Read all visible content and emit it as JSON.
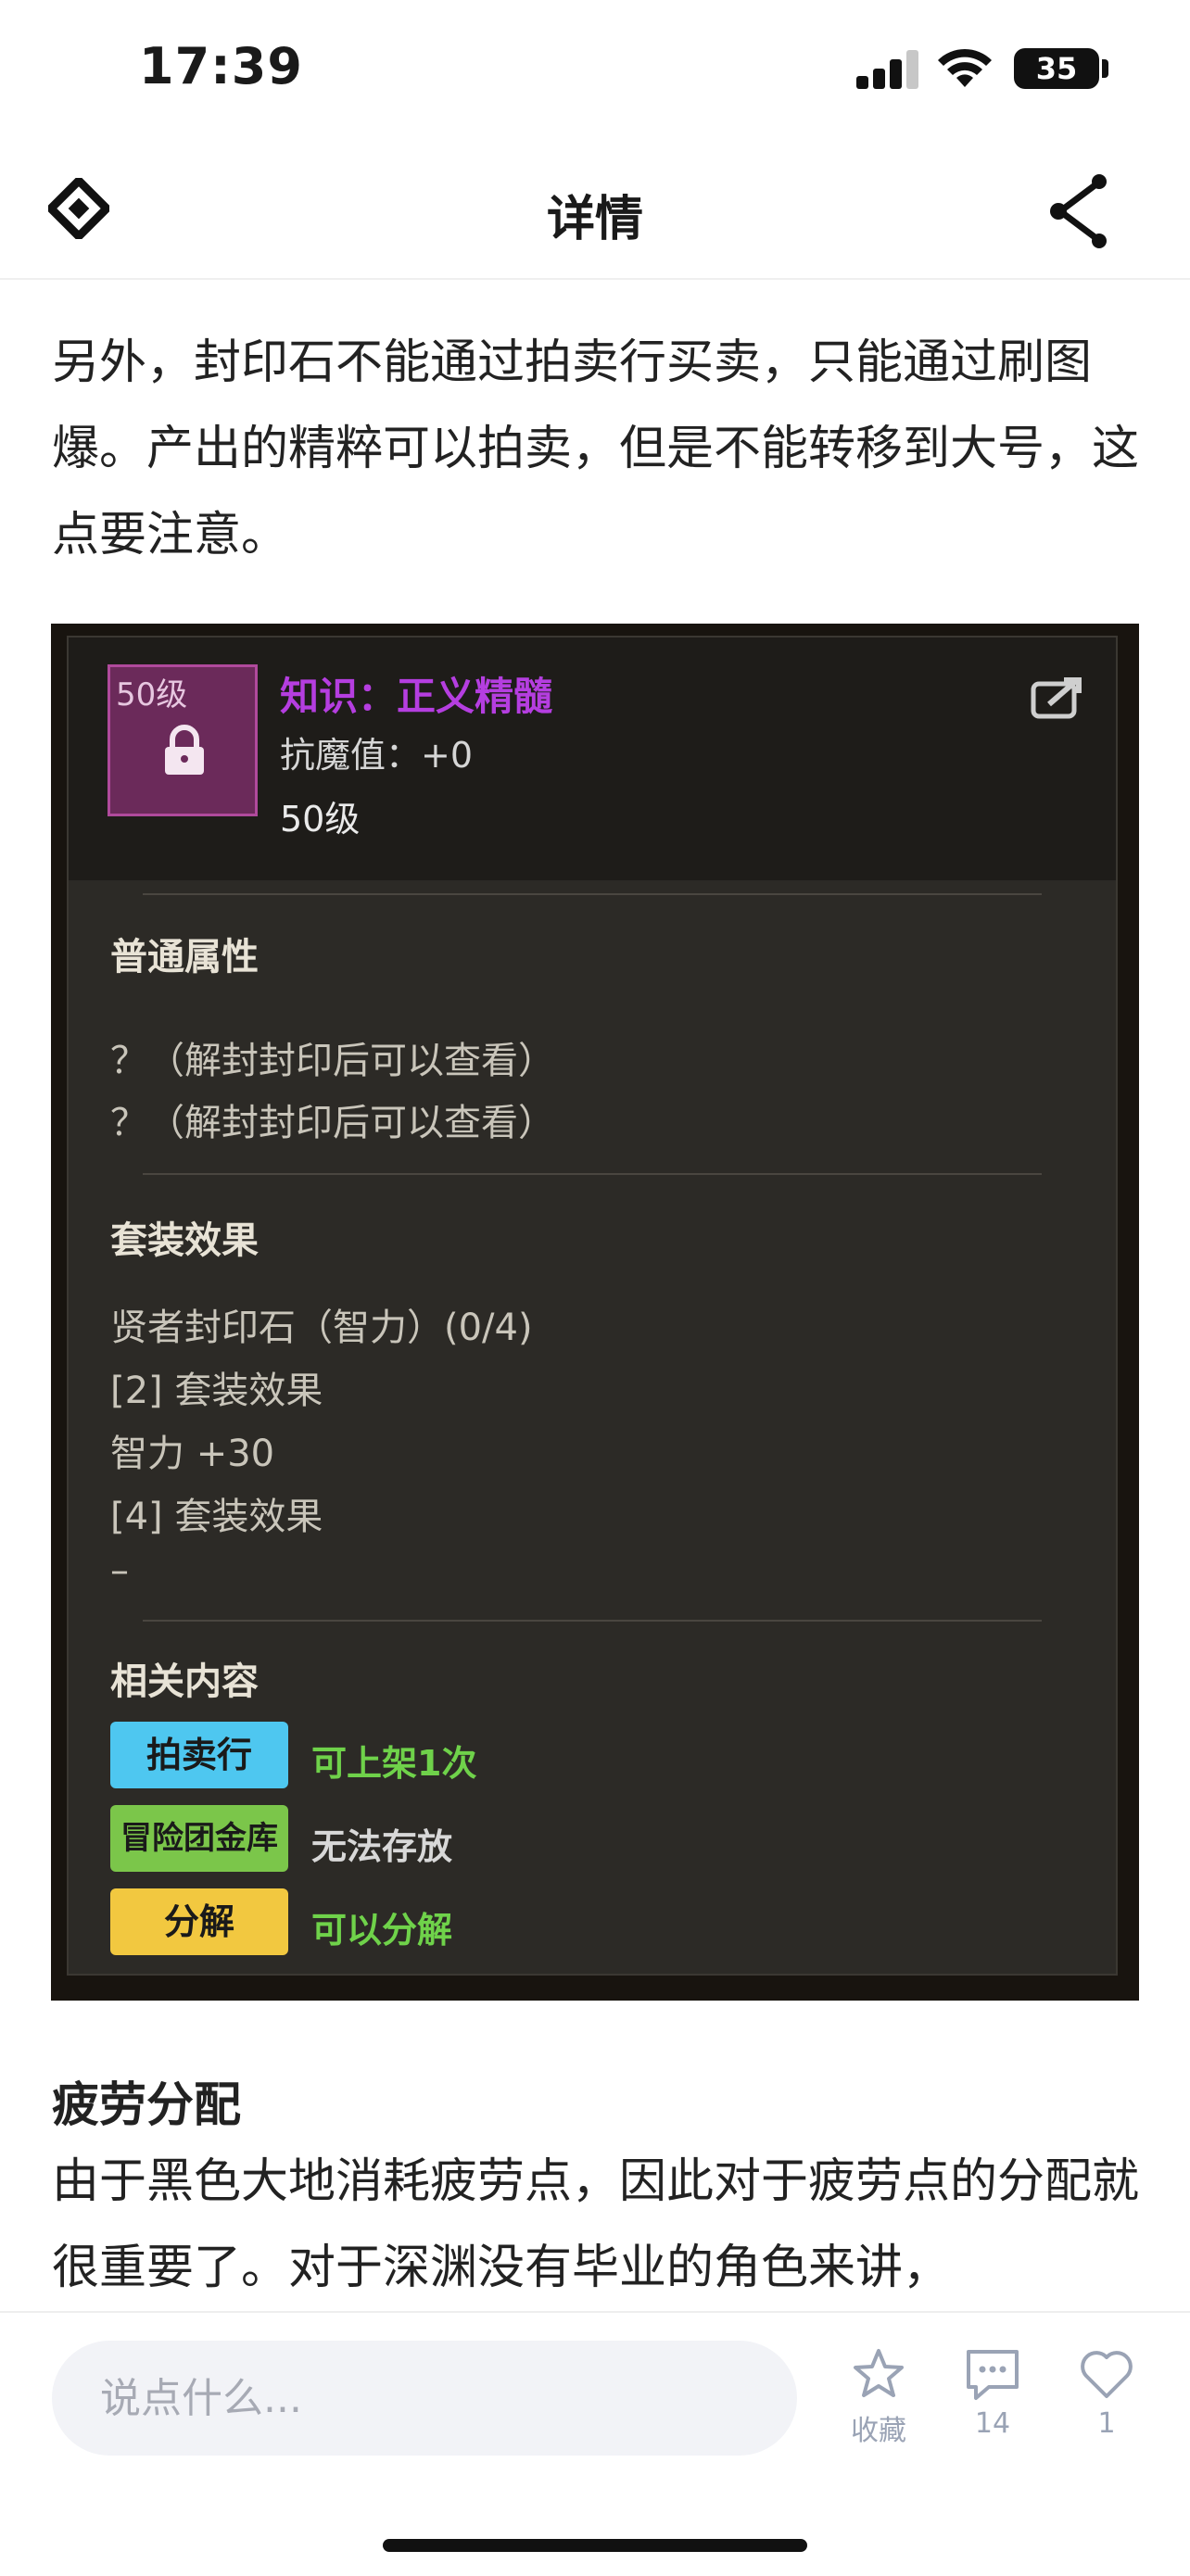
{
  "status_bar": {
    "time": "17:39",
    "battery": "35"
  },
  "nav": {
    "title": "详情",
    "logo_icon": "diamond-logo-icon",
    "share_icon": "share-icon"
  },
  "article": {
    "para1": "另外，封印石不能通过拍卖行买卖，只能通过刷图爆。产出的精粹可以拍卖，但是不能转移到大号，这点要注意。",
    "heading": "疲劳分配",
    "para2": "由于黑色大地消耗疲劳点，因此对于疲劳点的分配就很重要了。对于深渊没有毕业的角色来讲，"
  },
  "game_card": {
    "icon_level": "50级",
    "name": "知识：正义精髓",
    "resist": "抗魔值：+0",
    "level": "50级",
    "basic_title": "普通属性",
    "basic_lines": [
      "？（解封封印后可以查看）",
      "？（解封封印后可以查看）"
    ],
    "set_title": "套装效果",
    "set_lines": [
      "贤者封印石（智力）(0/4)",
      "[2] 套装效果",
      "智力 +30",
      "[4] 套装效果",
      "–"
    ],
    "related_title": "相关内容",
    "related": [
      {
        "tag": "拍卖行",
        "text": "可上架1次",
        "color": "#4ec7f0",
        "text_color": "#6fd24a"
      },
      {
        "tag": "冒险团金库",
        "text": "无法存放",
        "color": "#7bc64a",
        "text_color": "#d8d8d8"
      },
      {
        "tag": "分解",
        "text": "可以分解",
        "color": "#f2c840",
        "text_color": "#6fd24a"
      }
    ]
  },
  "bottom_bar": {
    "comment_placeholder": "说点什么...",
    "favorite_label": "收藏",
    "comment_count": "14",
    "like_count": "1"
  }
}
